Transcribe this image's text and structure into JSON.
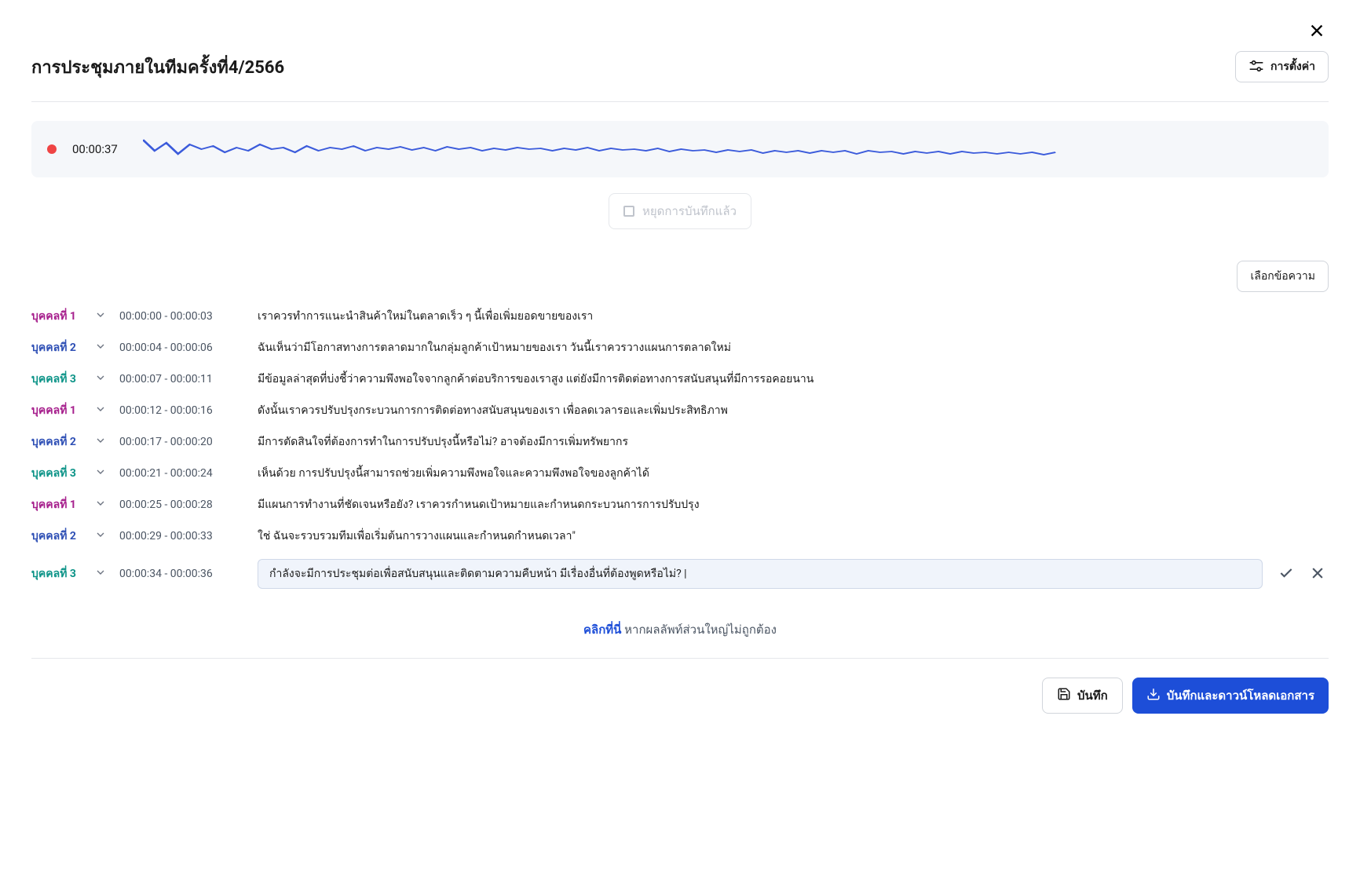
{
  "title": "การประชุมภายในทีมครั้งที่4/2566",
  "buttons": {
    "settings": "การตั้งค่า",
    "stop_recording": "หยุดการบันทึกแล้ว",
    "select_text": "เลือกข้อความ",
    "save": "บันทึก",
    "download": "บันทึกและดาวน์โหลดเอกสาร"
  },
  "recording": {
    "time": "00:00:37"
  },
  "feedback": {
    "link": "คลิกที่นี่",
    "text": " หากผลลัพท์ส่วนใหญ่ไม่ถูกต้อง"
  },
  "speakers": {
    "s1": "บุคคลที่ 1",
    "s2": "บุคคลที่ 2",
    "s3": "บุคคลที่ 3"
  },
  "transcript": [
    {
      "speaker": "s1",
      "time": "00:00:00 - 00:00:03",
      "text": "เราควรทำการแนะนำสินค้าใหม่ในตลาดเร็ว ๆ นี้เพื่อเพิ่มยอดขายของเรา"
    },
    {
      "speaker": "s2",
      "time": "00:00:04 - 00:00:06",
      "text": "ฉันเห็นว่ามีโอกาสทางการตลาดมากในกลุ่มลูกค้าเป้าหมายของเรา วันนี้เราควรวางแผนการตลาดใหม่"
    },
    {
      "speaker": "s3",
      "time": "00:00:07 - 00:00:11",
      "text": "มีข้อมูลล่าสุดที่บ่งชี้ว่าความพึงพอใจจากลูกค้าต่อบริการของเราสูง แต่ยังมีการติดต่อทางการสนับสนุนที่มีการรอคอยนาน"
    },
    {
      "speaker": "s1",
      "time": "00:00:12 - 00:00:16",
      "text": "ดังนั้นเราควรปรับปรุงกระบวนการการติดต่อทางสนับสนุนของเรา เพื่อลดเวลารอและเพิ่มประสิทธิภาพ"
    },
    {
      "speaker": "s2",
      "time": "00:00:17 - 00:00:20",
      "text": "มีการตัดสินใจที่ต้องการทำในการปรับปรุงนี้หรือไม่? อาจต้องมีการเพิ่มทรัพยากร"
    },
    {
      "speaker": "s3",
      "time": "00:00:21 - 00:00:24",
      "text": "เห็นด้วย การปรับปรุงนี้สามารถช่วยเพิ่มความพึงพอใจและความพึงพอใจของลูกค้าได้"
    },
    {
      "speaker": "s1",
      "time": "00:00:25 - 00:00:28",
      "text": "มีแผนการทำงานที่ชัดเจนหรือยัง? เราควรกำหนดเป้าหมายและกำหนดกระบวนการการปรับปรุง"
    },
    {
      "speaker": "s2",
      "time": "00:00:29 - 00:00:33",
      "text": "ใช่ ฉันจะรวบรวมทีมเพื่อเริ่มต้นการวางแผนและกำหนดกำหนดเวลา\""
    },
    {
      "speaker": "s3",
      "time": "00:00:34 - 00:00:36",
      "text": "กำลังจะมีการประชุมต่อเพื่อสนับสนุนและติดตามความคืบหน้า มีเรื่องอื่นที่ต้องพูดหรือไม่? |",
      "editing": true
    }
  ]
}
